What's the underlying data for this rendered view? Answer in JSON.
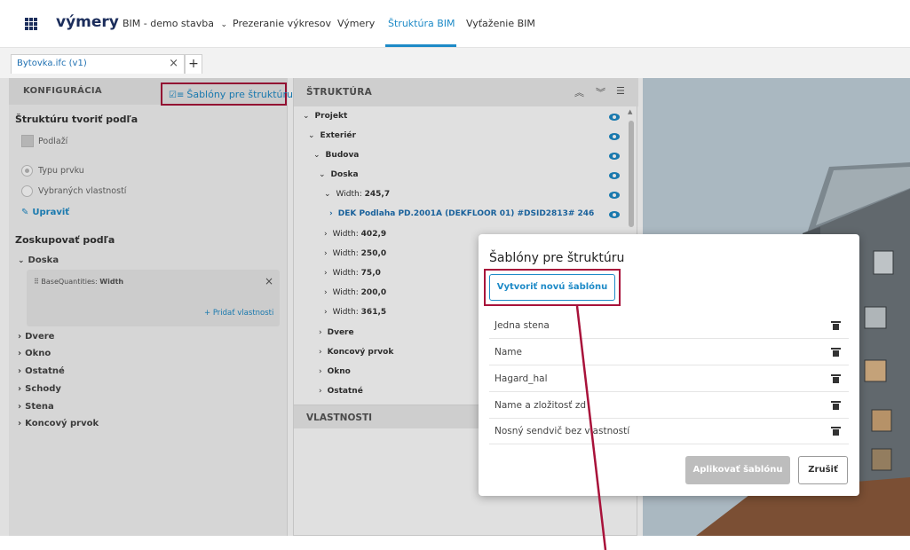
{
  "app": {
    "title": "výmery",
    "project_dropdown": "BIM - demo stavba",
    "nav": [
      {
        "label": "Prezeranie výkresov"
      },
      {
        "label": "Výmery"
      },
      {
        "label": "Štruktúra BIM",
        "active": true
      },
      {
        "label": "Vyťaženie BIM"
      }
    ]
  },
  "file_tab": {
    "label": "Bytovka.ifc (v1)",
    "close": "×",
    "add": "+"
  },
  "config_panel": {
    "header": "KONFIGURÁCIA",
    "templates_button": "Šablóny pre štruktúru",
    "structure_by_title": "Štruktúru tvoriť podľa",
    "floors_checkbox": "Podlaží",
    "radio_type": "Typu prvku",
    "radio_props": "Vybraných vlastností",
    "edit_link": "Upraviť",
    "group_by_title": "Zoskupovať podľa",
    "group_expanded": "Doska",
    "group_property_prefix": "BaseQuantities:",
    "group_property_name": "Width",
    "group_property_remove": "×",
    "add_property_link": "+ Pridať vlastnosti",
    "group_items": [
      "Dvere",
      "Okno",
      "Ostatné",
      "Schody",
      "Stena",
      "Koncový prvok"
    ]
  },
  "structure_panel": {
    "header": "ŠTRUKTÚRA",
    "rows": [
      {
        "label": "Projekt"
      },
      {
        "label": "Exteriér"
      },
      {
        "label": "Budova"
      },
      {
        "label": "Doska"
      },
      {
        "prefix": "Width:",
        "label": "245,7"
      },
      {
        "label": "DEK Podlaha PD.2001A (DEKFLOOR 01) #DSID2813# 246"
      },
      {
        "prefix": "Width:",
        "label": "402,9"
      },
      {
        "prefix": "Width:",
        "label": "250,0"
      },
      {
        "prefix": "Width:",
        "label": "75,0"
      },
      {
        "prefix": "Width:",
        "label": "200,0"
      },
      {
        "prefix": "Width:",
        "label": "361,5"
      },
      {
        "label": "Dvere"
      },
      {
        "label": "Koncový prvok"
      },
      {
        "label": "Okno"
      },
      {
        "label": "Ostatné"
      }
    ]
  },
  "properties_panel": {
    "header": "VLASTNOSTI"
  },
  "dialog": {
    "title": "Šablóny pre štruktúru",
    "new_template_button": "Vytvoriť novú šablónu",
    "templates": [
      "Jedna stena",
      "Name",
      "Hagard_hal",
      "Name a zložitosť zd",
      "Nosný sendvič bez vlastností"
    ],
    "apply_button": "Aplikovať šablónu",
    "cancel_button": "Zrušiť"
  },
  "colors": {
    "accent": "#1d8ac7",
    "brand": "#1c2e5c",
    "highlight_border": "#a8123a"
  }
}
